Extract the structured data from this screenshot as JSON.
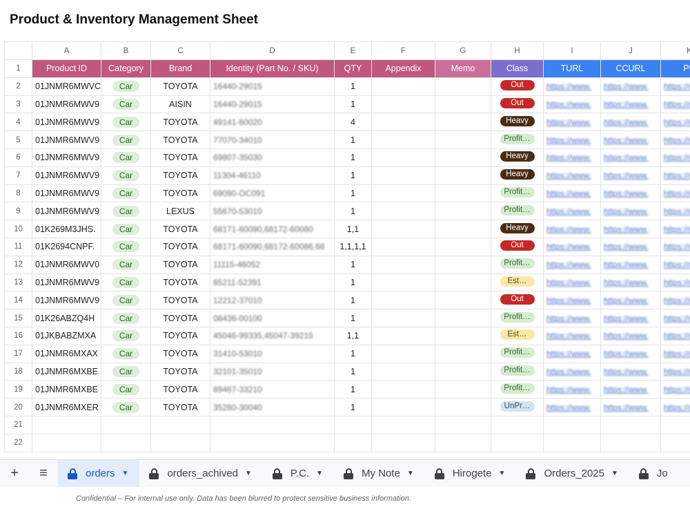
{
  "title": "Product & Inventory Management Sheet",
  "columns": [
    "A",
    "B",
    "C",
    "D",
    "E",
    "F",
    "G",
    "H",
    "I",
    "J",
    "K"
  ],
  "headers": {
    "product_id": "Product ID",
    "category": "Category",
    "brand": "Brand",
    "identity": "Identity (Part No. / SKU)",
    "qty": "QTY",
    "appendix": "Appendix",
    "memo": "Memo",
    "class": "Class",
    "turl": "TURL",
    "ccurl": "CCURL",
    "purl": "PU"
  },
  "header_colors": {
    "main": "#c0577f",
    "memo": "#c8709a",
    "class": "#7b6fce",
    "urls": "#3b82f0"
  },
  "rows": [
    {
      "n": "2",
      "pid": "01JNMR6MWVC",
      "cat": "Car",
      "brand": "TOYOTA",
      "sku": "16440-29015",
      "qty": "1",
      "cls": "Out",
      "cls_type": "out"
    },
    {
      "n": "3",
      "pid": "01JNMR6MWV9",
      "cat": "Car",
      "brand": "AISIN",
      "sku": "16440-29015",
      "qty": "1",
      "cls": "Out",
      "cls_type": "out"
    },
    {
      "n": "4",
      "pid": "01JNMR6MWV9",
      "cat": "Car",
      "brand": "TOYOTA",
      "sku": "49141-60020",
      "qty": "4",
      "cls": "Heavy",
      "cls_type": "heavy"
    },
    {
      "n": "5",
      "pid": "01JNMR6MWV9",
      "cat": "Car",
      "brand": "TOYOTA",
      "sku": "77070-34010",
      "qty": "1",
      "cls": "Profit…",
      "cls_type": "profit"
    },
    {
      "n": "6",
      "pid": "01JNMR6MWV9",
      "cat": "Car",
      "brand": "TOYOTA",
      "sku": "69807-35030",
      "qty": "1",
      "cls": "Heavy",
      "cls_type": "heavy"
    },
    {
      "n": "7",
      "pid": "01JNMR6MWV9",
      "cat": "Car",
      "brand": "TOYOTA",
      "sku": "11304-46110",
      "qty": "1",
      "cls": "Heavy",
      "cls_type": "heavy"
    },
    {
      "n": "8",
      "pid": "01JNMR6MWV9",
      "cat": "Car",
      "brand": "TOYOTA",
      "sku": "69090-OC091",
      "qty": "1",
      "cls": "Profit…",
      "cls_type": "profit"
    },
    {
      "n": "9",
      "pid": "01JNMR6MWV9",
      "cat": "Car",
      "brand": "LEXUS",
      "sku": "55670-53010",
      "qty": "1",
      "cls": "Profit…",
      "cls_type": "profit"
    },
    {
      "n": "10",
      "pid": "01K269M3JHS.",
      "cat": "Car",
      "brand": "TOYOTA",
      "sku": "68171-60090,68172-60080",
      "qty": "1,1",
      "cls": "Heavy",
      "cls_type": "heavy"
    },
    {
      "n": "11",
      "pid": "01K2694CNPF.",
      "cat": "Car",
      "brand": "TOYOTA",
      "sku": "68171-60090,68172-60086,68",
      "qty": "1,1,1,1",
      "cls": "Out",
      "cls_type": "out"
    },
    {
      "n": "12",
      "pid": "01JNMR6MWV0",
      "cat": "Car",
      "brand": "TOYOTA",
      "sku": "11115-46052",
      "qty": "1",
      "cls": "Profit…",
      "cls_type": "profit"
    },
    {
      "n": "13",
      "pid": "01JNMR6MWV9",
      "cat": "Car",
      "brand": "TOYOTA",
      "sku": "85211-52391",
      "qty": "1",
      "cls": "Est…",
      "cls_type": "est"
    },
    {
      "n": "14",
      "pid": "01JNMR6MWV9",
      "cat": "Car",
      "brand": "TOYOTA",
      "sku": "12212-37010",
      "qty": "1",
      "cls": "Out",
      "cls_type": "out"
    },
    {
      "n": "15",
      "pid": "01K26ABZQ4H",
      "cat": "Car",
      "brand": "TOYOTA",
      "sku": "08436-00100",
      "qty": "1",
      "cls": "Profit…",
      "cls_type": "profit"
    },
    {
      "n": "16",
      "pid": "01JKBABZMXA",
      "cat": "Car",
      "brand": "TOYOTA",
      "sku": "45046-99335,45047-39215",
      "qty": "1,1",
      "cls": "Est…",
      "cls_type": "est"
    },
    {
      "n": "17",
      "pid": "01JNMR6MXAX",
      "cat": "Car",
      "brand": "TOYOTA",
      "sku": "31410-53010",
      "qty": "1",
      "cls": "Profit…",
      "cls_type": "profit"
    },
    {
      "n": "18",
      "pid": "01JNMR6MXBE",
      "cat": "Car",
      "brand": "TOYOTA",
      "sku": "32101-35010",
      "qty": "1",
      "cls": "Profit…",
      "cls_type": "profit"
    },
    {
      "n": "19",
      "pid": "01JNMR6MXBE",
      "cat": "Car",
      "brand": "TOYOTA",
      "sku": "89467-33210",
      "qty": "1",
      "cls": "Profit…",
      "cls_type": "profit"
    },
    {
      "n": "20",
      "pid": "01JNMR6MXER",
      "cat": "Car",
      "brand": "TOYOTA",
      "sku": "35280-30040",
      "qty": "1",
      "cls": "UnPr…",
      "cls_type": "unpr"
    }
  ],
  "empty_rows": [
    "21",
    "22"
  ],
  "link_text": "https://www.",
  "sheet_tabs": [
    {
      "label": "orders",
      "active": true
    },
    {
      "label": "orders_achived",
      "active": false
    },
    {
      "label": "P.C.",
      "active": false
    },
    {
      "label": "My Note",
      "active": false
    },
    {
      "label": "Hirogete",
      "active": false
    },
    {
      "label": "Orders_2025",
      "active": false
    },
    {
      "label": "Jo",
      "active": false
    }
  ],
  "icons": {
    "add_sheet": "plus-icon",
    "all_sheets": "menu-icon",
    "tab_lock": "lock-icon",
    "tab_menu": "caret-down-icon"
  },
  "footer_note": "Confidential – For internal use only. Data has been blurred to protect sensitive business information."
}
